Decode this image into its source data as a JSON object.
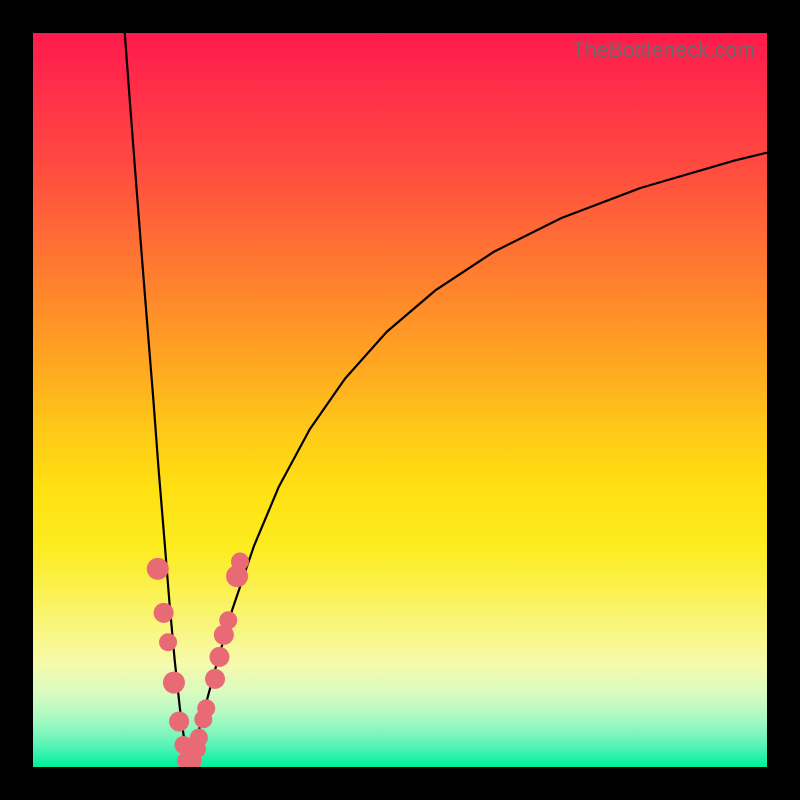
{
  "watermark": "TheBottleneck.com",
  "chart_data": {
    "type": "line",
    "title": "",
    "xlabel": "",
    "ylabel": "",
    "xlim": [
      0,
      100
    ],
    "ylim": [
      0,
      100
    ],
    "series": [
      {
        "name": "left-branch",
        "x": [
          12.5,
          13.2,
          14.0,
          14.8,
          15.6,
          16.4,
          17.1,
          17.9,
          18.6,
          19.3,
          20.0,
          20.7,
          21.3
        ],
        "y": [
          100.0,
          90.6,
          80.2,
          69.9,
          59.9,
          50.0,
          40.7,
          31.0,
          22.3,
          14.6,
          8.1,
          3.0,
          0.0
        ]
      },
      {
        "name": "right-branch",
        "x": [
          21.3,
          22.0,
          23.1,
          24.9,
          27.2,
          30.1,
          33.5,
          37.7,
          42.5,
          48.2,
          54.9,
          62.8,
          72.0,
          82.8,
          95.5,
          100.0
        ],
        "y": [
          0.0,
          2.7,
          6.9,
          13.6,
          21.6,
          30.1,
          38.2,
          46.0,
          52.9,
          59.3,
          65.0,
          70.2,
          74.8,
          78.9,
          82.6,
          83.7
        ]
      }
    ],
    "markers": [
      {
        "x": 17.0,
        "y": 27.0,
        "r": 11
      },
      {
        "x": 17.8,
        "y": 21.0,
        "r": 10
      },
      {
        "x": 18.4,
        "y": 17.0,
        "r": 9
      },
      {
        "x": 19.2,
        "y": 11.5,
        "r": 11
      },
      {
        "x": 19.9,
        "y": 6.2,
        "r": 10
      },
      {
        "x": 20.5,
        "y": 3.0,
        "r": 9
      },
      {
        "x": 21.0,
        "y": 0.8,
        "r": 10
      },
      {
        "x": 21.6,
        "y": 0.8,
        "r": 10
      },
      {
        "x": 22.2,
        "y": 2.5,
        "r": 10
      },
      {
        "x": 22.6,
        "y": 4.0,
        "r": 9
      },
      {
        "x": 23.2,
        "y": 6.5,
        "r": 9
      },
      {
        "x": 23.6,
        "y": 8.0,
        "r": 9
      },
      {
        "x": 24.8,
        "y": 12.0,
        "r": 10
      },
      {
        "x": 25.4,
        "y": 15.0,
        "r": 10
      },
      {
        "x": 26.0,
        "y": 18.0,
        "r": 10
      },
      {
        "x": 26.6,
        "y": 20.0,
        "r": 9
      },
      {
        "x": 27.8,
        "y": 26.0,
        "r": 11
      },
      {
        "x": 28.2,
        "y": 28.0,
        "r": 9
      }
    ],
    "marker_style": {
      "fill": "#e86a74",
      "stroke": "none"
    },
    "line_style": {
      "stroke": "#000000",
      "width": 2.2
    }
  }
}
